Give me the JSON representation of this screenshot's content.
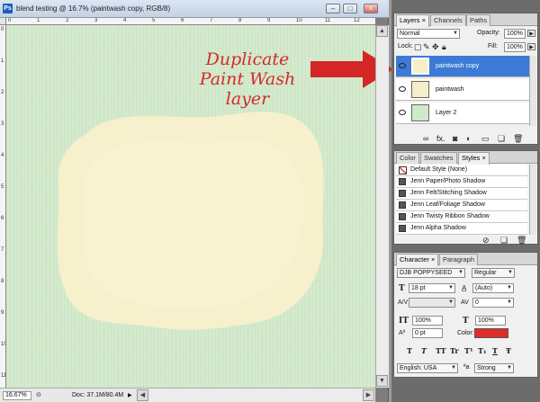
{
  "document": {
    "title": "blend testing @ 16.7% (paintwash copy, RGB/8)",
    "doc_icon": "Ps",
    "zoom": "16.67%",
    "doc_size": "Doc: 37.1M/80.4M",
    "ruler_top": [
      "0",
      "1",
      "2",
      "3",
      "4",
      "5",
      "6",
      "7",
      "8",
      "9",
      "10",
      "11",
      "12"
    ],
    "ruler_left": [
      "0",
      "1",
      "2",
      "3",
      "4",
      "5",
      "6",
      "7",
      "8",
      "9",
      "10",
      "11"
    ],
    "canvas_color": "#d2e9cb",
    "paintwash_color": "#f6f0cc"
  },
  "annotation": {
    "lines": [
      "Duplicate",
      "Paint Wash",
      "layer"
    ],
    "color": "#d42a2a"
  },
  "layers_panel": {
    "tabs": [
      "Layers ×",
      "Channels",
      "Paths"
    ],
    "blend_mode": "Normal",
    "opacity_label": "Opacity:",
    "opacity": "100%",
    "lock_label": "Lock:",
    "fill_label": "Fill:",
    "fill": "100%",
    "layers": [
      {
        "name": "paintwash copy",
        "selected": true
      },
      {
        "name": "paintwash",
        "selected": false
      },
      {
        "name": "Layer 2",
        "selected": false
      }
    ],
    "footer_icons": [
      "link-icon",
      "fx-icon",
      "mask-icon",
      "adjustment-icon",
      "group-icon",
      "new-layer-icon",
      "trash-icon"
    ]
  },
  "styles_panel": {
    "tabs": [
      "Color",
      "Swatches",
      "Styles ×"
    ],
    "styles": [
      "Default Style (None)",
      "Jenn Paper/Photo Shadow",
      "Jenn Felt/Stitching Shadow",
      "Jenn Leaf/Foliage Shadow",
      "Jenn Twisty Ribbon Shadow",
      "Jenn Alpha Shadow"
    ]
  },
  "character_panel": {
    "tabs": [
      "Character ×",
      "Paragraph"
    ],
    "font_family": "DJB POPPYSEED",
    "font_style": "Regular",
    "font_size": "18 pt",
    "leading": "(Auto)",
    "kerning": "",
    "tracking": "0",
    "vertical_scale": "100%",
    "horizontal_scale": "100%",
    "baseline_shift": "0 pt",
    "color_label": "Color:",
    "text_color": "#e02b2b",
    "type_buttons": [
      "T",
      "T",
      "TT",
      "Tr",
      "T¹",
      "T₁",
      "T",
      "Ŧ"
    ],
    "language": "English: USA",
    "antialias_label": "ªa",
    "antialias": "Strong"
  }
}
